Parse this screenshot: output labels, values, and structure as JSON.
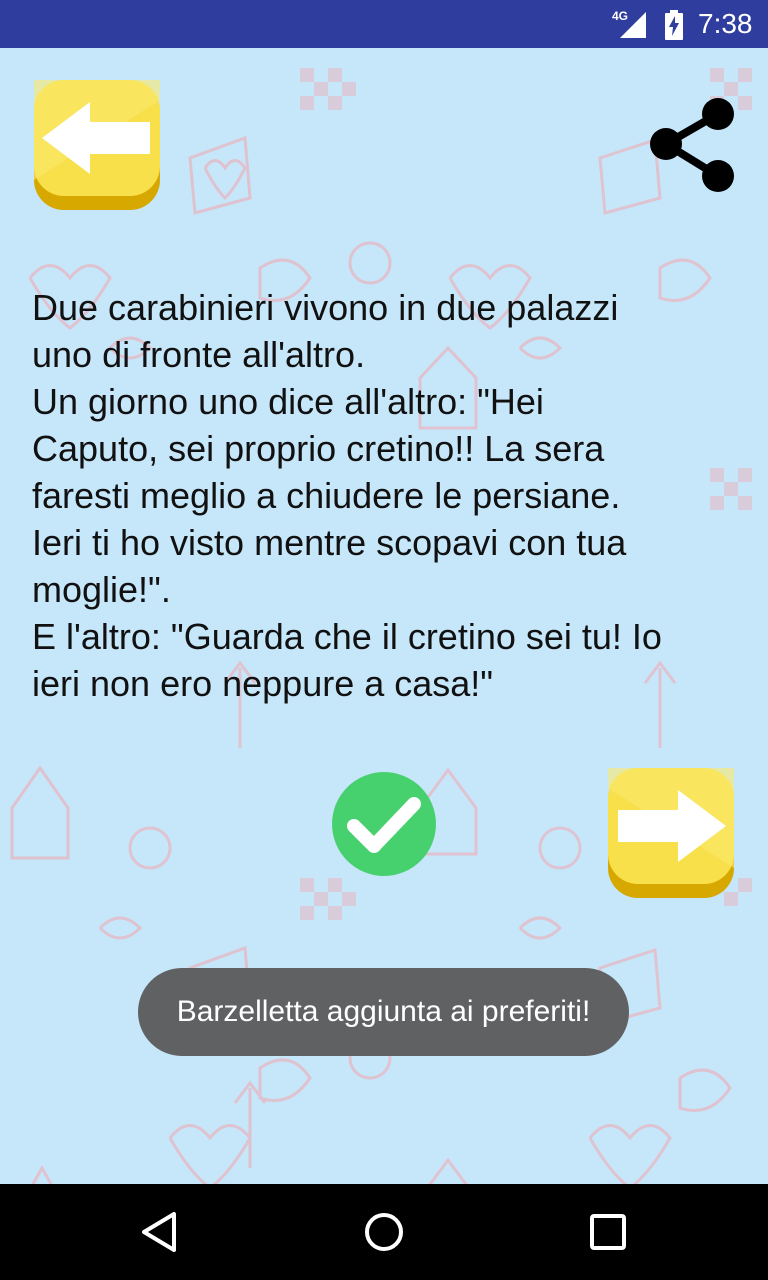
{
  "status_bar": {
    "network": "4G",
    "time": "7:38"
  },
  "toolbar": {
    "back_icon": "arrow-left-icon",
    "share_icon": "share-icon"
  },
  "joke": {
    "text": "Due carabinieri vivono in due palazzi\nuno di fronte all'altro.\nUn giorno uno dice all'altro: \"Hei\nCaputo, sei proprio cretino!! La sera\nfaresti meglio a chiudere le persiane.\nIeri ti ho visto mentre scopavi con tua\nmoglie!\".\nE l'altro: \"Guarda che il cretino sei tu! Io\nieri non ero neppure a casa!\""
  },
  "actions": {
    "favorite_icon": "check-icon",
    "next_icon": "arrow-right-icon"
  },
  "toast": {
    "message": "Barzelletta aggiunta ai preferiti!"
  },
  "colors": {
    "status_bar": "#2f3e9e",
    "background": "#c6e6fa",
    "button_yellow": "#f7e04a",
    "favorite_green": "#47d16e",
    "toast_bg": "#5f6163"
  }
}
